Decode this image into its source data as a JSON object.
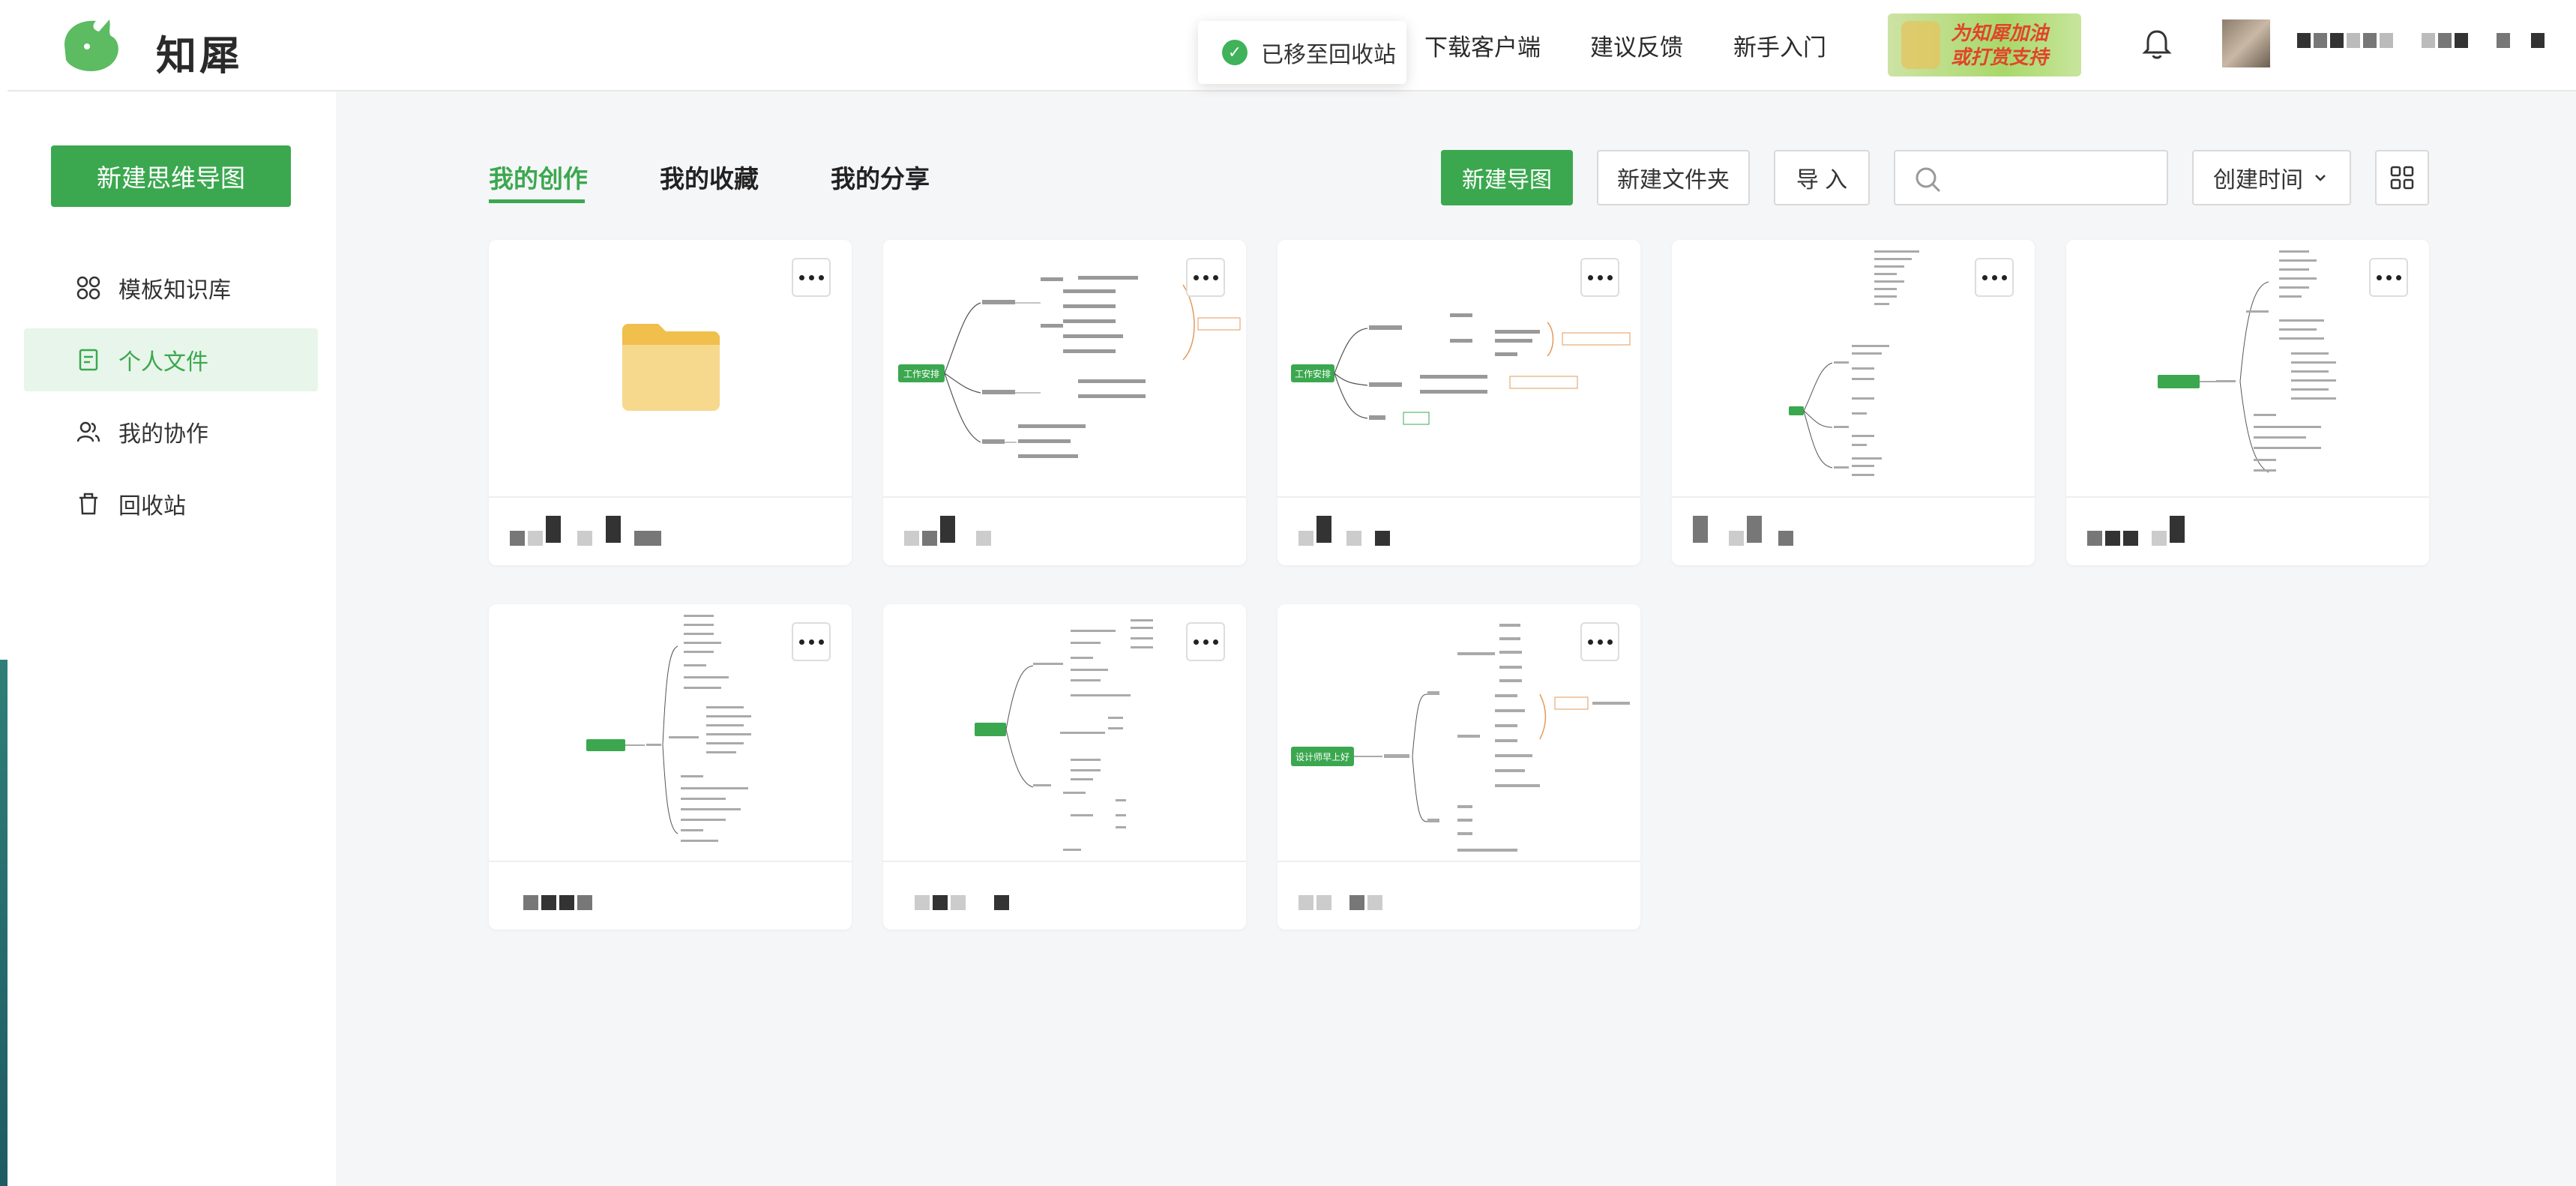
{
  "app": {
    "brand": "知犀"
  },
  "toast": {
    "message": "已移至回收站"
  },
  "header": {
    "links": [
      "下载客户端",
      "建议反馈",
      "新手入门"
    ],
    "banner_text_1": "为知犀加油",
    "banner_text_2": "或打赏支持"
  },
  "sidebar": {
    "new_button": "新建思维导图",
    "items": [
      {
        "label": "模板知识库",
        "icon": "grid-icon"
      },
      {
        "label": "个人文件",
        "icon": "file-icon"
      },
      {
        "label": "我的协作",
        "icon": "users-icon"
      },
      {
        "label": "回收站",
        "icon": "trash-icon"
      }
    ]
  },
  "tabs": [
    "我的创作",
    "我的收藏",
    "我的分享"
  ],
  "toolbar": {
    "new_map": "新建导图",
    "new_folder": "新建文件夹",
    "import": "导 入",
    "search_placeholder": "",
    "sort_label": "创建时间"
  },
  "colors": {
    "accent": "#3ba84f",
    "folder": "#f5d58a"
  },
  "cards": [
    {
      "type": "folder"
    },
    {
      "type": "mindmap",
      "root": "工作安排"
    },
    {
      "type": "mindmap",
      "root": "工作安排"
    },
    {
      "type": "mindmap",
      "root": ""
    },
    {
      "type": "mindmap",
      "root": ""
    },
    {
      "type": "mindmap",
      "root": ""
    },
    {
      "type": "mindmap",
      "root": ""
    },
    {
      "type": "mindmap",
      "root": "设计师早上好"
    }
  ]
}
